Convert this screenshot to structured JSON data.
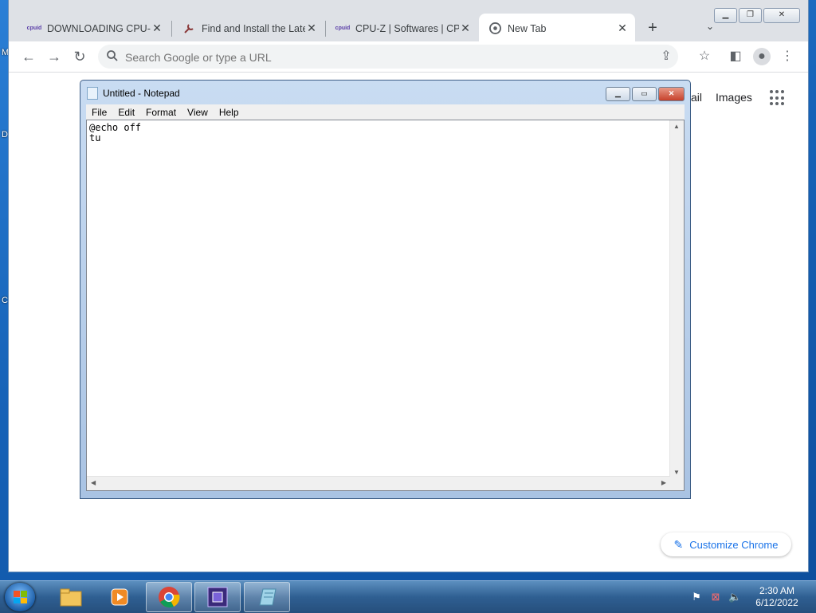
{
  "desktop": {
    "side_letters": [
      "M",
      "D",
      "C"
    ]
  },
  "chrome": {
    "tabs": [
      {
        "title": "DOWNLOADING CPU-Z",
        "favicon": "cpuid-icon"
      },
      {
        "title": "Find and Install the Late",
        "favicon": "wrench-icon"
      },
      {
        "title": "CPU-Z | Softwares | CPU",
        "favicon": "cpuid-icon"
      },
      {
        "title": "New Tab",
        "favicon": "chrome-icon",
        "active": true
      }
    ],
    "omnibox": {
      "placeholder": "Search Google or type a URL",
      "value": ""
    },
    "page": {
      "gmail_partial": "ail",
      "images": "Images",
      "customize": "Customize Chrome"
    }
  },
  "notepad": {
    "title": "Untitled - Notepad",
    "menu": [
      "File",
      "Edit",
      "Format",
      "View",
      "Help"
    ],
    "content": "@echo off\ntu"
  },
  "taskbar": {
    "apps": [
      "explorer-icon",
      "media-player-icon",
      "chrome-icon",
      "cpu-z-icon",
      "notepad-icon"
    ],
    "clock": {
      "time": "2:30 AM",
      "date": "6/12/2022"
    }
  },
  "colors": {
    "accent": "#1a73e8",
    "taskbar": "#2f5f92",
    "tabbar": "#dee1e6"
  }
}
